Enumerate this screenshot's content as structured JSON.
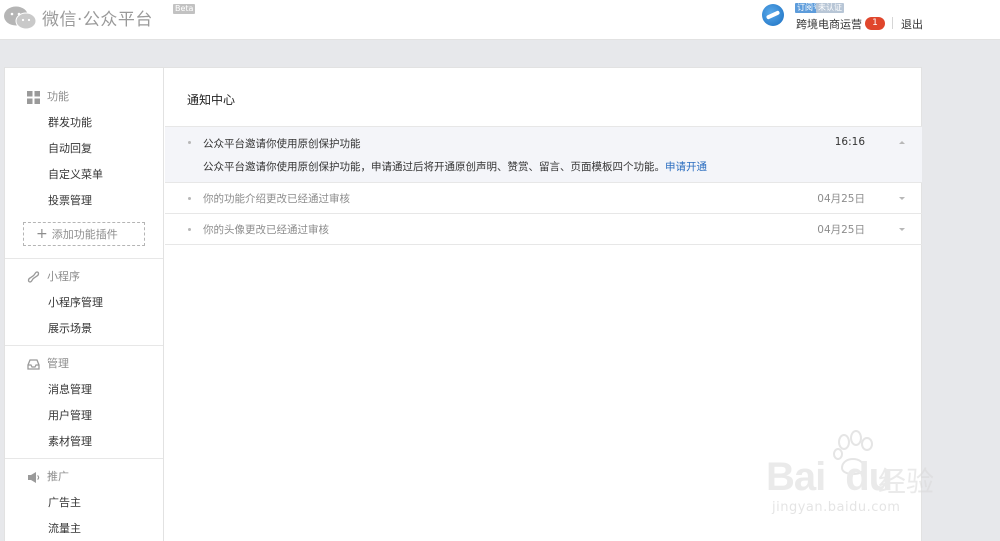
{
  "header": {
    "logo_text": "微信·公众平台",
    "beta": "Beta",
    "account": {
      "tag_subscription": "订阅号",
      "tag_unverified": "未认证",
      "name": "跨境电商运营",
      "badge_count": "1",
      "logout": "退出"
    }
  },
  "sidebar": {
    "groups": [
      {
        "title": "功能",
        "icon": "grid-icon",
        "items": [
          "群发功能",
          "自动回复",
          "自定义菜单",
          "投票管理"
        ],
        "add_plugin": "添加功能插件"
      },
      {
        "title": "小程序",
        "icon": "mini-program-icon",
        "items": [
          "小程序管理",
          "展示场景"
        ]
      },
      {
        "title": "管理",
        "icon": "inbox-icon",
        "items": [
          "消息管理",
          "用户管理",
          "素材管理"
        ]
      },
      {
        "title": "推广",
        "icon": "megaphone-icon",
        "items": [
          "广告主",
          "流量主"
        ]
      }
    ]
  },
  "content": {
    "title": "通知中心",
    "notices": [
      {
        "title": "公众平台邀请你使用原创保护功能",
        "time": "16:16",
        "body": "公众平台邀请你使用原创保护功能，申请通过后将开通原创声明、赞赏、留言、页面模板四个功能。",
        "link": "申请开通"
      },
      {
        "title": "你的功能介绍更改已经通过审核",
        "time": "04月25日"
      },
      {
        "title": "你的头像更改已经通过审核",
        "time": "04月25日"
      }
    ]
  },
  "watermark": {
    "brand": "Bai",
    "brand2": "du",
    "cn": "经验",
    "url": "jingyan.baidu.com"
  }
}
